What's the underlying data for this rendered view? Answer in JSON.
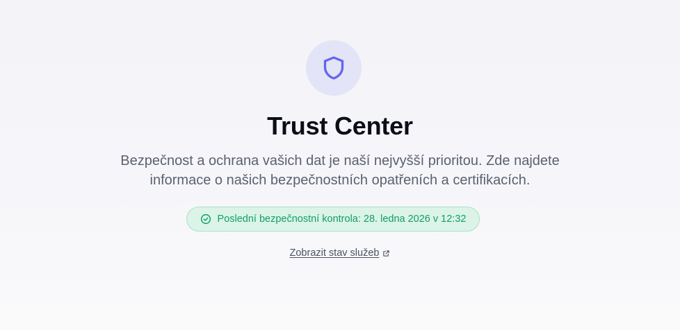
{
  "hero": {
    "icon": "shield-icon",
    "title": "Trust Center",
    "subtitle": "Bezpečnost a ochrana vašich dat je naší nejvyšší prioritou. Zde najdete informace o našich bezpečnostních opatřeních a certifikacích."
  },
  "status": {
    "icon": "check-circle-icon",
    "text": "Poslední bezpečnostní kontrola: 28. ledna 2026 v 12:32"
  },
  "link": {
    "label": "Zobrazit stav služeb",
    "icon": "external-link-icon"
  },
  "colors": {
    "accent": "#6366f1",
    "accent_bg": "#e3e4f7",
    "success": "#0f9f6a",
    "success_bg": "#dcf3e8"
  }
}
